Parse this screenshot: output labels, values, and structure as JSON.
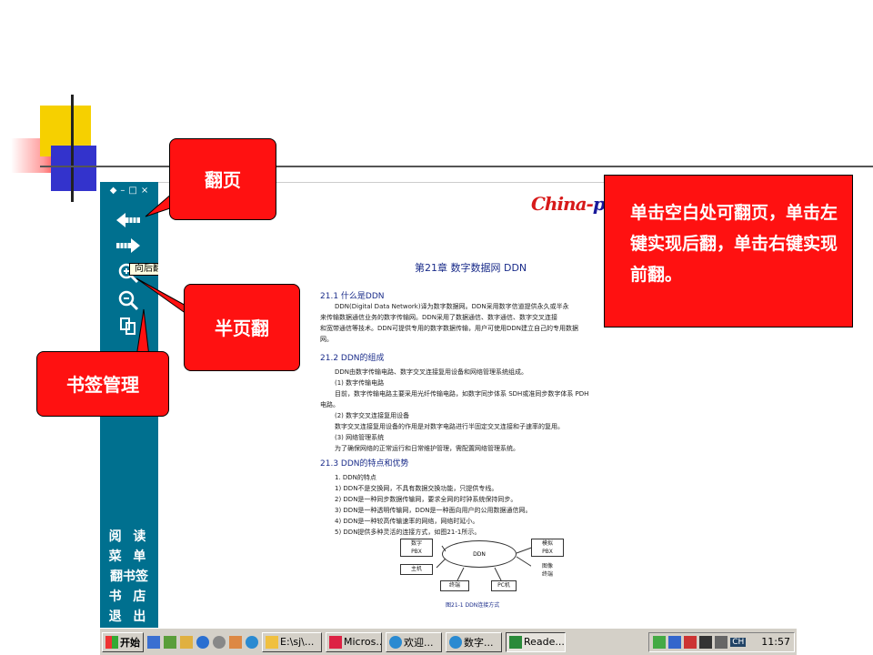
{
  "callouts": {
    "page_turn": "翻页",
    "half_page": "半页翻",
    "bookmark": "书签管理",
    "tip": "单击空白处可翻页，单击左键实现后翻，单击右键实现前翻。"
  },
  "reader": {
    "window_controls": [
      "◆",
      "–",
      "□",
      "×"
    ],
    "tooltip": "向后翻页",
    "menu": [
      "阅 读",
      "菜 单",
      "翻书签",
      "书 店",
      "退 出"
    ]
  },
  "document": {
    "brand": "China-pub",
    "chapter": "第21章    数字数据网 DDN",
    "sections": [
      "21.1  什么是DDN",
      "21.2  DDN的组成",
      "21.3  DDN的特点和优势"
    ],
    "para1": [
      "DDN(Digital Data Network)译为数字数据网。DDN采用数字信道提供永久或半永",
      "来传输数据通信业务的数字传输网。DDN采用了数据通信、数字通信、数字交叉连接",
      "和宽带通信等技术。DDN可提供专用的数字数据传输，用户可使用DDN建立自己的专用数据",
      "网。"
    ],
    "para2": [
      "DDN由数字传输电路、数字交叉连接复用设备和网络管理系统组成。",
      "(1) 数字传输电路",
      "目前，数字传输电路主要采用光纤传输电路，如数字同步体系 SDH或准同步数字体系 PDH",
      "电路。",
      "(2) 数字交叉连接复用设备",
      "数字交叉连接复用设备的作用是对数字电路进行半固定交叉连接和子速率的复用。",
      "(3) 网络管理系统",
      "为了确保网络的正常运行和日常维护管理，需配置网络管理系统。"
    ],
    "features": [
      "1. DDN的特点",
      "1) DDN不是交换网，不具有数据交换功能，只提供专线。",
      "2) DDN是一种同步数据传输网，要求全网的时钟系统保持同步。",
      "3) DDN是一种透明传输网，DDN是一种面向用户的公用数据通信网。",
      "4) DDN是一种较高传输速率的网络，网络时延小。",
      "5) DDN提供多种灵活的连接方式，如图21-1所示。"
    ],
    "diagram": {
      "center": "DDN",
      "boxes": [
        "数字\nPBX",
        "主机",
        "终端",
        "PC机",
        "模拟\nPBX",
        "图像\n终端"
      ],
      "caption": "图21-1   DDN连接方式"
    }
  },
  "taskbar": {
    "start": "开始",
    "tasks": [
      "E:\\sj\\...",
      "Micros...",
      "欢迎...",
      "数字...",
      "Reade..."
    ],
    "tray_lang": "CH",
    "time": "11:57"
  }
}
